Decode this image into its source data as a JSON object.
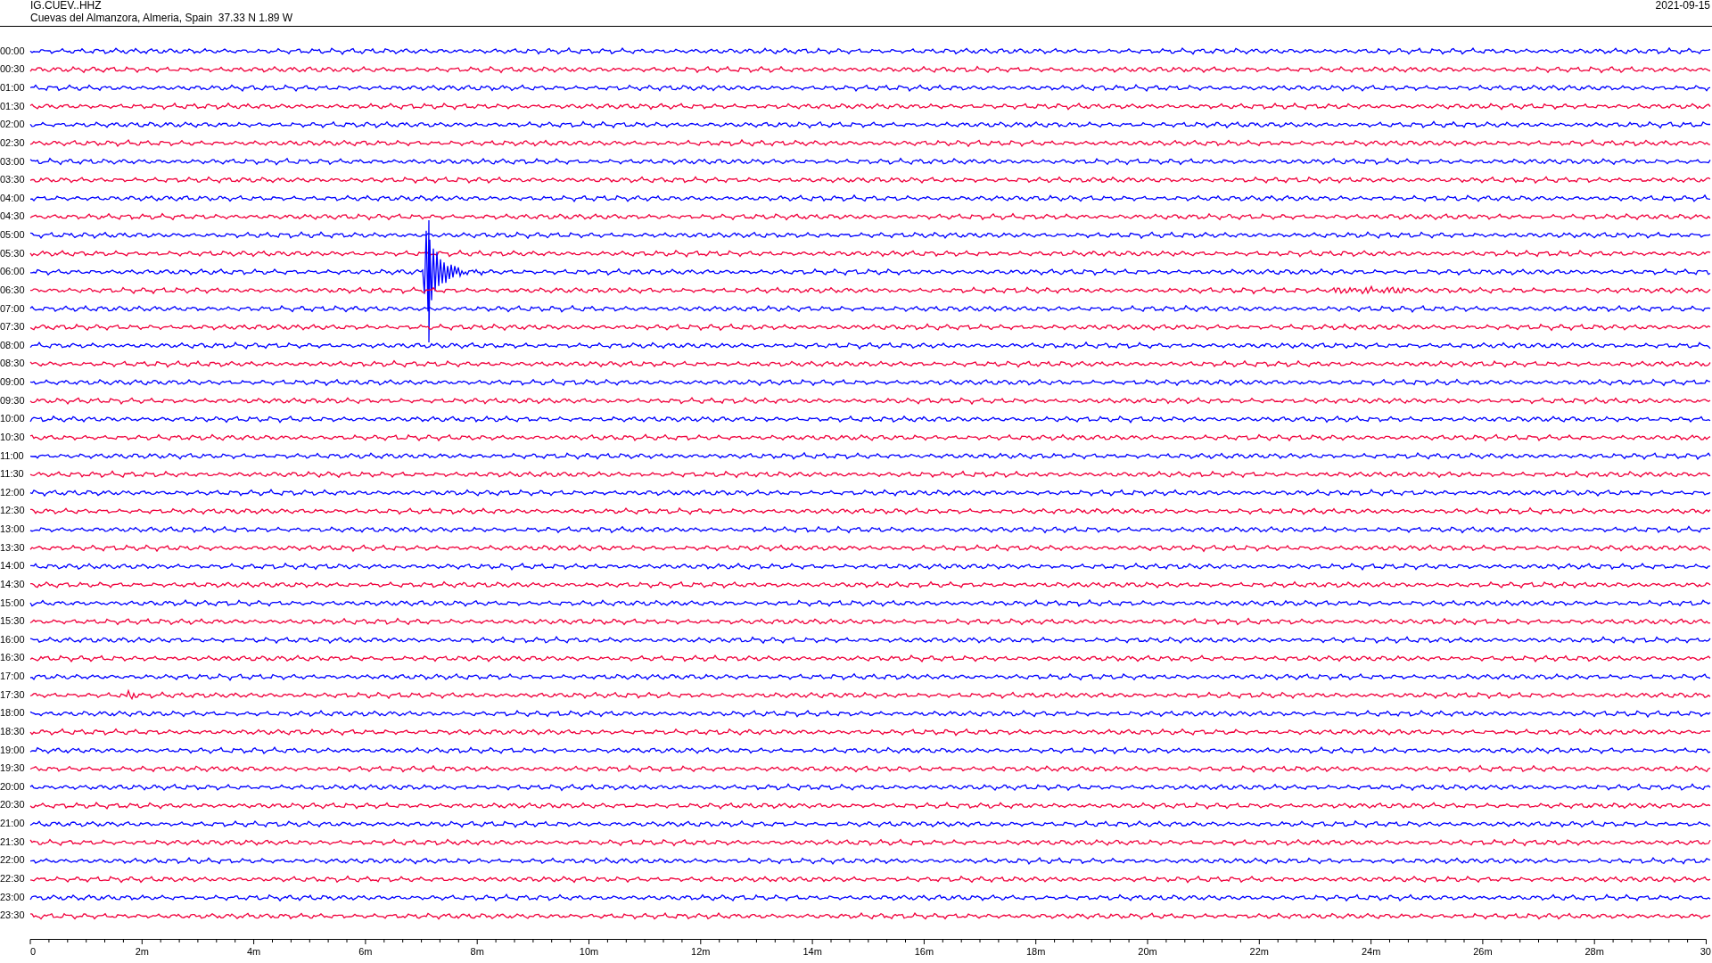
{
  "header": {
    "channel": "IG.CUEV..HHZ",
    "station": "Cuevas del Almanzora, Almeria, Spain  37.33 N 1.89 W",
    "date": "2021-09-15"
  },
  "rows": [
    {
      "label": "00:00",
      "color": "#0000ff"
    },
    {
      "label": "00:30",
      "color": "#f0003c"
    },
    {
      "label": "01:00",
      "color": "#0000ff"
    },
    {
      "label": "01:30",
      "color": "#f0003c"
    },
    {
      "label": "02:00",
      "color": "#0000ff"
    },
    {
      "label": "02:30",
      "color": "#f0003c"
    },
    {
      "label": "03:00",
      "color": "#0000ff"
    },
    {
      "label": "03:30",
      "color": "#f0003c"
    },
    {
      "label": "04:00",
      "color": "#0000ff"
    },
    {
      "label": "04:30",
      "color": "#f0003c"
    },
    {
      "label": "05:00",
      "color": "#0000ff"
    },
    {
      "label": "05:30",
      "color": "#f0003c"
    },
    {
      "label": "06:00",
      "color": "#0000ff"
    },
    {
      "label": "06:30",
      "color": "#f0003c"
    },
    {
      "label": "07:00",
      "color": "#0000ff"
    },
    {
      "label": "07:30",
      "color": "#f0003c"
    },
    {
      "label": "08:00",
      "color": "#0000ff"
    },
    {
      "label": "08:30",
      "color": "#f0003c"
    },
    {
      "label": "09:00",
      "color": "#0000ff"
    },
    {
      "label": "09:30",
      "color": "#f0003c"
    },
    {
      "label": "10:00",
      "color": "#0000ff"
    },
    {
      "label": "10:30",
      "color": "#f0003c"
    },
    {
      "label": "11:00",
      "color": "#0000ff"
    },
    {
      "label": "11:30",
      "color": "#f0003c"
    },
    {
      "label": "12:00",
      "color": "#0000ff"
    },
    {
      "label": "12:30",
      "color": "#f0003c"
    },
    {
      "label": "13:00",
      "color": "#0000ff"
    },
    {
      "label": "13:30",
      "color": "#f0003c"
    },
    {
      "label": "14:00",
      "color": "#0000ff"
    },
    {
      "label": "14:30",
      "color": "#f0003c"
    },
    {
      "label": "15:00",
      "color": "#0000ff"
    },
    {
      "label": "15:30",
      "color": "#f0003c"
    },
    {
      "label": "16:00",
      "color": "#0000ff"
    },
    {
      "label": "16:30",
      "color": "#f0003c"
    },
    {
      "label": "17:00",
      "color": "#0000ff"
    },
    {
      "label": "17:30",
      "color": "#f0003c"
    },
    {
      "label": "18:00",
      "color": "#0000ff"
    },
    {
      "label": "18:30",
      "color": "#f0003c"
    },
    {
      "label": "19:00",
      "color": "#0000ff"
    },
    {
      "label": "19:30",
      "color": "#f0003c"
    },
    {
      "label": "20:00",
      "color": "#0000ff"
    },
    {
      "label": "20:30",
      "color": "#f0003c"
    },
    {
      "label": "21:00",
      "color": "#0000ff"
    },
    {
      "label": "21:30",
      "color": "#f0003c"
    },
    {
      "label": "22:00",
      "color": "#0000ff"
    },
    {
      "label": "22:30",
      "color": "#f0003c"
    },
    {
      "label": "23:00",
      "color": "#0000ff"
    },
    {
      "label": "23:30",
      "color": "#f0003c"
    }
  ],
  "x_axis": {
    "ticks": [
      "0",
      "2m",
      "4m",
      "6m",
      "8m",
      "10m",
      "12m",
      "14m",
      "16m",
      "18m",
      "20m",
      "22m",
      "24m",
      "26m",
      "28m",
      "30"
    ]
  }
}
